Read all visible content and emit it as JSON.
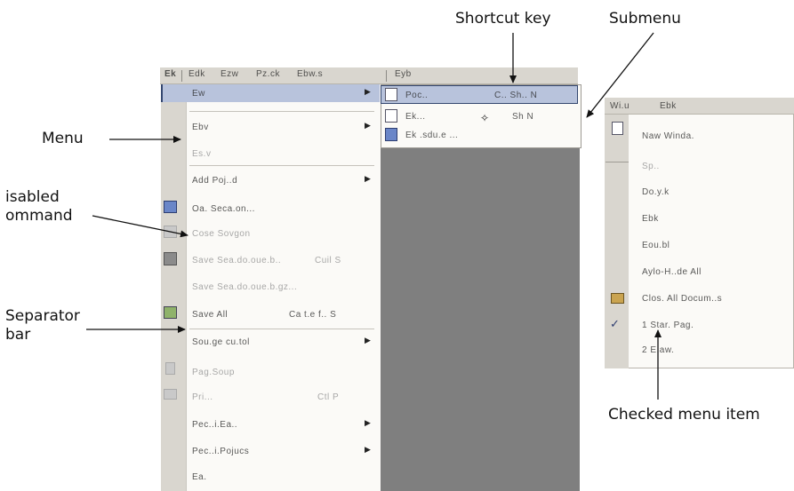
{
  "labels": {
    "shortcut_key": "Shortcut key",
    "submenu": "Submenu",
    "menu": "Menu",
    "disabled_command_line1": "isabled",
    "disabled_command_line2": "ommand",
    "separator_bar_line1": "Separator",
    "separator_bar_line2": "bar",
    "checked_menu_item": "Checked menu item"
  },
  "menubar": {
    "items": [
      "Ek",
      "Edk",
      "Ezw",
      "Pz.ck",
      "Ebw.s",
      "Eyb"
    ]
  },
  "main_menu": {
    "items": [
      {
        "label": "Ew",
        "shortcut": "",
        "submenu": true,
        "state": "highlighted"
      },
      {
        "label": "Ebv",
        "shortcut": "",
        "submenu": true,
        "state": "normal"
      },
      {
        "label": "Es.v",
        "shortcut": "",
        "submenu": false,
        "state": "disabled"
      },
      {
        "label": "Add Poj..d",
        "shortcut": "",
        "submenu": true,
        "state": "normal"
      },
      {
        "label": "Oa. Seca.on...",
        "shortcut": "",
        "submenu": false,
        "state": "normal"
      },
      {
        "label": "Cose Sovgon",
        "shortcut": "",
        "submenu": false,
        "state": "disabled"
      },
      {
        "label": "Save Sea.do.oue.b..",
        "shortcut": "Cuil S",
        "submenu": false,
        "state": "disabled"
      },
      {
        "label": "Save Sea.do.oue.b.gz...",
        "shortcut": "",
        "submenu": false,
        "state": "disabled"
      },
      {
        "label": "Save All",
        "shortcut": "Ca t.e f.. S",
        "submenu": false,
        "state": "normal"
      },
      {
        "label": "Sou.ge cu.tol",
        "shortcut": "",
        "submenu": true,
        "state": "normal"
      },
      {
        "label": "Pag.Soup",
        "shortcut": "",
        "submenu": false,
        "state": "disabled"
      },
      {
        "label": "Pri...",
        "shortcut": "Ctl P",
        "submenu": false,
        "state": "disabled"
      },
      {
        "label": "Pec..i.Ea..",
        "shortcut": "",
        "submenu": true,
        "state": "normal"
      },
      {
        "label": "Pec..i.Pojucs",
        "shortcut": "",
        "submenu": true,
        "state": "normal"
      },
      {
        "label": "Ea.",
        "shortcut": "",
        "submenu": false,
        "state": "normal"
      }
    ]
  },
  "submenu": {
    "items": [
      {
        "label": "Poc..",
        "shortcut": "C.. Sh.. N",
        "state": "highlighted"
      },
      {
        "label": "Ek...",
        "shortcut": "Sh N",
        "state": "normal"
      },
      {
        "label": "Ek .sdu.e ...",
        "shortcut": "",
        "state": "normal"
      }
    ]
  },
  "right_window": {
    "menubar": [
      "Wi.u",
      "Ebk"
    ],
    "items": [
      {
        "label": "Naw Winda.",
        "icon": "doc"
      },
      {
        "label": "Sp..",
        "icon": "none",
        "state": "disabled"
      },
      {
        "label": "Do.y.k",
        "icon": "none"
      },
      {
        "label": "Ebk",
        "icon": "none"
      },
      {
        "label": "Eou.bl",
        "icon": "none"
      },
      {
        "label": "Aylo-H..de All",
        "icon": "none"
      },
      {
        "label": "Clos. All Docum..s",
        "icon": "folder"
      },
      {
        "label": "1 Star. Pag.",
        "icon": "check"
      },
      {
        "label": "2 E.aw.",
        "icon": "none"
      }
    ]
  }
}
